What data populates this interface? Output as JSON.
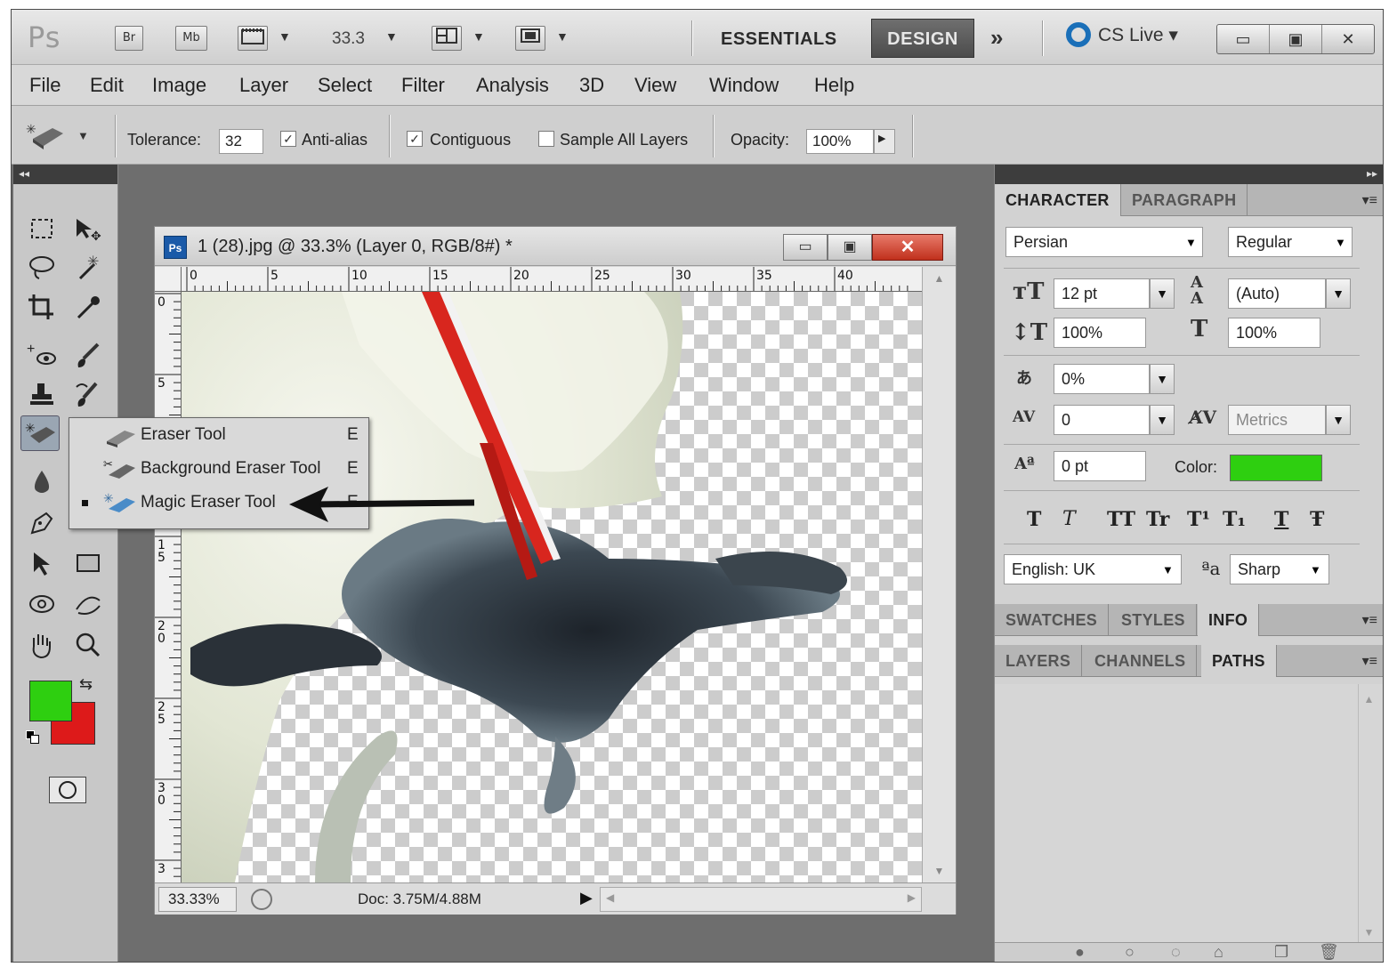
{
  "appbar": {
    "logo": "Ps",
    "bridge": "Br",
    "minibridge": "Mb",
    "zoom": "33.3",
    "workspace_essentials": "ESSENTIALS",
    "workspace_design": "DESIGN",
    "more": "»",
    "cslive": "CS Live ▾",
    "win_min": "▭",
    "win_max": "▣",
    "win_close": "✕"
  },
  "menu": [
    "File",
    "Edit",
    "Image",
    "Layer",
    "Select",
    "Filter",
    "Analysis",
    "3D",
    "View",
    "Window",
    "Help"
  ],
  "options": {
    "tolerance_label": "Tolerance:",
    "tolerance_value": "32",
    "antialias_label": "Anti-alias",
    "antialias_checked": true,
    "contiguous_label": "Contiguous",
    "contiguous_checked": true,
    "sample_all_label": "Sample All Layers",
    "sample_all_checked": false,
    "opacity_label": "Opacity:",
    "opacity_value": "100%"
  },
  "toolpanel": {
    "fg_color": "#2ecf10",
    "bg_color": "#dd1a1a"
  },
  "flyout": {
    "items": [
      {
        "label": "Eraser Tool",
        "key": "E",
        "selected": false,
        "icon": "eraser-icon"
      },
      {
        "label": "Background Eraser Tool",
        "key": "E",
        "selected": false,
        "icon": "background-eraser-icon"
      },
      {
        "label": "Magic Eraser Tool",
        "key": "E",
        "selected": true,
        "icon": "magic-eraser-icon"
      }
    ]
  },
  "document": {
    "title": "1 (28).jpg @ 33.3% (Layer 0, RGB/8#) *",
    "ps_badge": "Ps",
    "ruler_h": [
      "0",
      "5",
      "10",
      "15",
      "20",
      "25",
      "30",
      "35",
      "40"
    ],
    "ruler_v": [
      "0",
      "5",
      "1 0",
      "1 5",
      "2 0",
      "2 5",
      "3 0",
      "3"
    ],
    "status_zoom": "33.33%",
    "status_doc": "Doc: 3.75M/4.88M"
  },
  "character": {
    "tabs": [
      "CHARACTER",
      "PARAGRAPH"
    ],
    "font_family": "Persian",
    "font_style": "Regular",
    "font_size": "12 pt",
    "leading": "(Auto)",
    "vertical_scale": "100%",
    "horizontal_scale": "100%",
    "tsume": "0%",
    "tracking": "0",
    "kerning": "Metrics",
    "baseline_shift": "0 pt",
    "color_label": "Color:",
    "color_value": "#2ecf10",
    "style_buttons": [
      "T",
      "T",
      "TT",
      "Tr",
      "T¹",
      "T₁",
      "T",
      "Ŧ"
    ],
    "language": "English: UK",
    "aa_label": "ªa",
    "antialias": "Sharp"
  },
  "panels": {
    "row1": [
      "SWATCHES",
      "STYLES",
      "INFO"
    ],
    "row2": [
      "LAYERS",
      "CHANNELS",
      "PATHS"
    ]
  }
}
